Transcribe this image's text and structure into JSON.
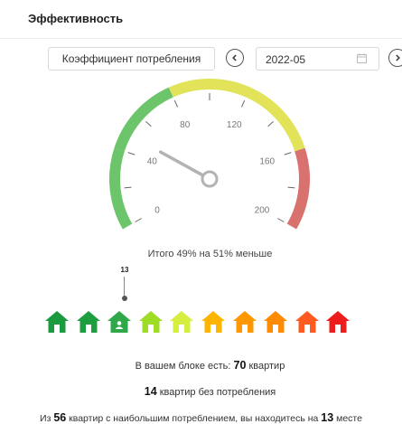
{
  "header": {
    "title": "Эффективность"
  },
  "toolbar": {
    "metric_select": "Коэффициент потребления",
    "date_value": "2022-05",
    "prev_icon": "chevron-left-icon",
    "next_icon": "chevron-right-icon",
    "calendar_icon": "calendar-icon"
  },
  "gauge": {
    "min": 0,
    "max": 200,
    "value": 49,
    "ticks": [
      "0",
      "40",
      "80",
      "120",
      "160",
      "200"
    ],
    "colors": {
      "low": "#6cc46b",
      "mid": "#e3e35a",
      "high": "#d9726f"
    }
  },
  "summary": "Итого 49% на 51% меньше",
  "ranking": {
    "marker_label": "13",
    "marker_index": 2,
    "house_colors": [
      "#1b9a3f",
      "#1f9e40",
      "#2fa84a",
      "#9fdc26",
      "#d6ef3f",
      "#ffb400",
      "#ff9800",
      "#ff8c00",
      "#ff5a1f",
      "#ee1c1c"
    ]
  },
  "stats": {
    "line1_prefix": "В вашем блоке есть: ",
    "line1_count": "70",
    "line1_suffix": " квартир",
    "line2_count": "14",
    "line2_suffix": " квартир без потребления",
    "line3_a": "Из ",
    "line3_count": "56",
    "line3_b": " квартир с наибольшим потреблением, вы находитесь на ",
    "line3_place": "13",
    "line3_c": " месте"
  }
}
